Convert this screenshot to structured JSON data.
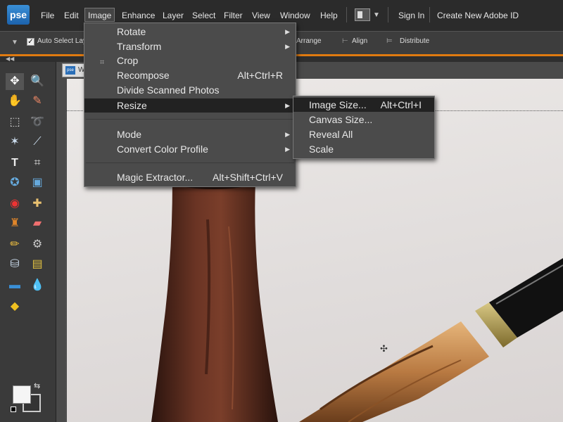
{
  "app": {
    "logo": "pse"
  },
  "menubar": {
    "items": [
      "File",
      "Edit",
      "Image",
      "Enhance",
      "Layer",
      "Select",
      "Filter",
      "View",
      "Window",
      "Help"
    ],
    "sign_in": "Sign In",
    "create_id": "Create New Adobe ID"
  },
  "options": {
    "auto_select": "Auto Select Layer",
    "arrange": "Arrange",
    "align": "Align",
    "distribute": "Distribute"
  },
  "document": {
    "tab_label": "W"
  },
  "image_menu": {
    "items": [
      {
        "label": "Rotate",
        "shortcut": "",
        "submenu": true
      },
      {
        "label": "Transform",
        "shortcut": "",
        "submenu": true
      },
      {
        "label": "Crop",
        "shortcut": "",
        "submenu": false
      },
      {
        "label": "Recompose",
        "shortcut": "Alt+Ctrl+R",
        "submenu": false
      },
      {
        "label": "Divide Scanned Photos",
        "shortcut": "",
        "submenu": false
      },
      {
        "label": "Resize",
        "shortcut": "",
        "submenu": true
      },
      {
        "label": "Mode",
        "shortcut": "",
        "submenu": true
      },
      {
        "label": "Convert Color Profile",
        "shortcut": "",
        "submenu": true
      },
      {
        "label": "Magic Extractor...",
        "shortcut": "Alt+Shift+Ctrl+V",
        "submenu": false
      }
    ]
  },
  "resize_menu": {
    "items": [
      {
        "label": "Image Size...",
        "shortcut": "Alt+Ctrl+I"
      },
      {
        "label": "Canvas Size...",
        "shortcut": ""
      },
      {
        "label": "Reveal All",
        "shortcut": ""
      },
      {
        "label": "Scale",
        "shortcut": ""
      }
    ]
  },
  "colors": {
    "accent": "#e07a10",
    "highlight": "#222222"
  }
}
